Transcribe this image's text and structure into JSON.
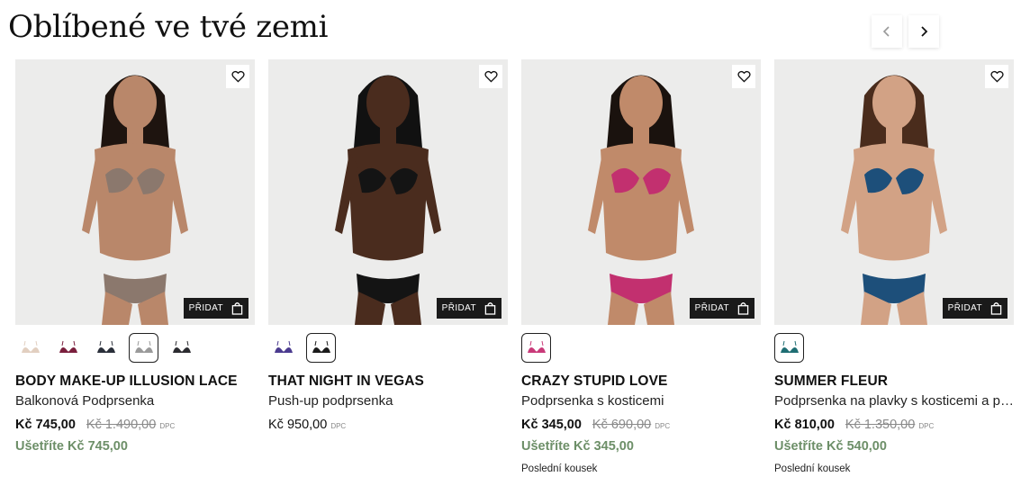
{
  "section": {
    "title": "Oblíbené ve tvé zemi"
  },
  "nav": {
    "prev_icon": "chevron-left-icon",
    "next_icon": "chevron-right-icon"
  },
  "products": [
    {
      "name": "BODY MAKE-UP ILLUSION LACE",
      "subtitle": "Balkonová Podprsenka",
      "price": "Kč 745,00",
      "old_price": "Kč 1.490,00",
      "price_tag": "DPC",
      "saving": "Ušetříte Kč 745,00",
      "add_label": "PŘIDAT",
      "swatch_colors": [
        "#e2cfc0",
        "#7a1f3d",
        "#2a2f3a",
        "#9a9a9a",
        "#2b2b30"
      ],
      "selected_swatch": 3,
      "photo_bg": "#ececeb",
      "garment_color": "#8b786d",
      "skin_color": "#b9876a",
      "hair_color": "#1e140f"
    },
    {
      "name": "THAT NIGHT IN VEGAS",
      "subtitle": "Push-up podprsenka",
      "price": "Kč 950,00",
      "price_tag": "DPC",
      "add_label": "PŘIDAT",
      "swatch_colors": [
        "#4b3b8f",
        "#1b1b1b"
      ],
      "selected_swatch": 1,
      "photo_bg": "#ececeb",
      "garment_color": "#141414",
      "skin_color": "#4a2c1e",
      "hair_color": "#111111"
    },
    {
      "name": "CRAZY STUPID LOVE",
      "subtitle": "Podprsenka s kosticemi",
      "price": "Kč 345,00",
      "old_price": "Kč 690,00",
      "price_tag": "DPC",
      "saving": "Ušetříte Kč 345,00",
      "last_piece": "Poslední kousek",
      "add_label": "PŘIDAT",
      "swatch_colors": [
        "#c93a79"
      ],
      "selected_swatch": 0,
      "photo_bg": "#ececeb",
      "garment_color": "#c2306f",
      "skin_color": "#c08a6a",
      "hair_color": "#1a120e"
    },
    {
      "name": "SUMMER FLEUR",
      "subtitle": "Podprsenka na plavky s kosticemi a po…",
      "price": "Kč 810,00",
      "old_price": "Kč 1.350,00",
      "price_tag": "DPC",
      "saving": "Ušetříte Kč 540,00",
      "last_piece": "Poslední kousek",
      "add_label": "PŘIDAT",
      "swatch_colors": [
        "#1f6e73"
      ],
      "selected_swatch": 0,
      "photo_bg": "#ececeb",
      "garment_color": "#1d4f7a",
      "skin_color": "#d2a285",
      "hair_color": "#4a2c1c"
    }
  ],
  "colors": {
    "accent_saving": "#6d8f68",
    "button_dark": "#1a1a1a"
  }
}
